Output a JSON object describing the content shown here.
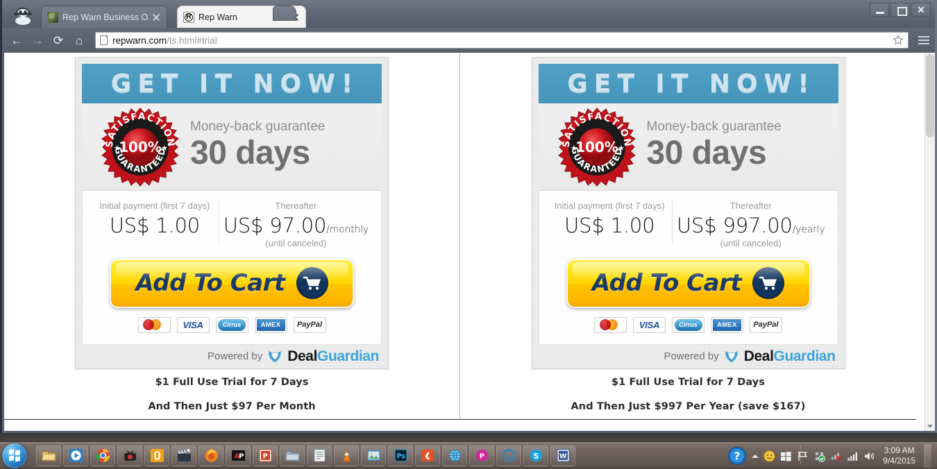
{
  "browser": {
    "tabs": [
      {
        "title": "Rep Warn Business Oppor",
        "favicon": "photo-favicon",
        "active": false
      },
      {
        "title": "Rep Warn",
        "favicon": "repwarn-logo-favicon",
        "active": true
      }
    ],
    "address": {
      "url_domain": "repwarn.com",
      "url_path": "/ts.html#trial",
      "page_icon": "document-icon"
    },
    "nav": {
      "back": "←",
      "forward": "→",
      "reload": "⟳",
      "home": "⌂"
    },
    "window_controls": {
      "minimize": "minimize",
      "maximize": "maximize",
      "close": "✕"
    },
    "bookmark_star": "star-icon",
    "menu": "hamburger-menu-icon"
  },
  "offers": [
    {
      "id": "monthly",
      "headline": "GET IT NOW!",
      "seal": {
        "top_text": "SATISFACTION",
        "center_text": "100%",
        "bottom_text": "GUARANTEED"
      },
      "guarantee_label": "Money-back guarantee",
      "guarantee_value": "30 days",
      "initial_label": "Initial payment (first 7 days)",
      "initial_amount": "US$ 1.00",
      "thereafter_label": "Thereafter",
      "thereafter_amount": "US$ 97.00",
      "thereafter_period": "/monthly",
      "thereafter_note": "(until canceled)",
      "cta_label": "Add To Cart",
      "payment_methods": [
        "MasterCard",
        "VISA",
        "Cirrus",
        "AMEX",
        "PayPal"
      ],
      "powered_by_label": "Powered by",
      "powered_by_brand_1": "Deal",
      "powered_by_brand_2": "Guardian",
      "under_line_1": "$1 Full Use Trial for 7 Days",
      "under_line_2": "And Then Just $97 Per Month"
    },
    {
      "id": "yearly",
      "headline": "GET IT NOW!",
      "seal": {
        "top_text": "SATISFACTION",
        "center_text": "100%",
        "bottom_text": "GUARANTEED"
      },
      "guarantee_label": "Money-back guarantee",
      "guarantee_value": "30 days",
      "initial_label": "Initial payment (first 7 days)",
      "initial_amount": "US$ 1.00",
      "thereafter_label": "Thereafter",
      "thereafter_amount": "US$ 997.00",
      "thereafter_period": "/yearly",
      "thereafter_note": "(until canceled)",
      "cta_label": "Add To Cart",
      "payment_methods": [
        "MasterCard",
        "VISA",
        "Cirrus",
        "AMEX",
        "PayPal"
      ],
      "powered_by_label": "Powered by",
      "powered_by_brand_1": "Deal",
      "powered_by_brand_2": "Guardian",
      "under_line_1": "$1 Full Use Trial for 7 Days",
      "under_line_2": "And Then Just $997 Per Year (save $167)"
    }
  ],
  "taskbar": {
    "start": "windows-start-orb",
    "items": [
      "file-explorer-icon",
      "windows-media-player-icon",
      "google-chrome-icon",
      "tv-recorder-icon",
      "opera-icon",
      "movie-maker-icon",
      "mozilla-firefox-icon",
      "anypic-icon",
      "powerpoint-icon",
      "folder-icon",
      "notepad-icon",
      "vlc-icon",
      "picture-viewer-icon",
      "photoshop-icon",
      "pdf-tool-icon",
      "internet-globe-icon",
      "pinnacle-icon",
      "quicktime-icon",
      "skype-icon",
      "word-icon"
    ],
    "tray": [
      "help-question-icon",
      "show-hidden-chevron",
      "smiley-icon",
      "windows-flag-icon",
      "action-center-flag-icon",
      "network-shield-check-icon",
      "network-error-icon",
      "signal-bars-icon",
      "volume-speaker-icon"
    ],
    "clock_time": "3:09 AM",
    "clock_date": "9/4/2015"
  },
  "colors": {
    "header_blue": "#4a9bc1",
    "cta_yellow": "#ffd400",
    "cta_text_navy": "#1b3a63",
    "seal_red": "#c1121b",
    "guardian_blue": "#3ba4d6",
    "card_gray": "#e9e9e9"
  }
}
